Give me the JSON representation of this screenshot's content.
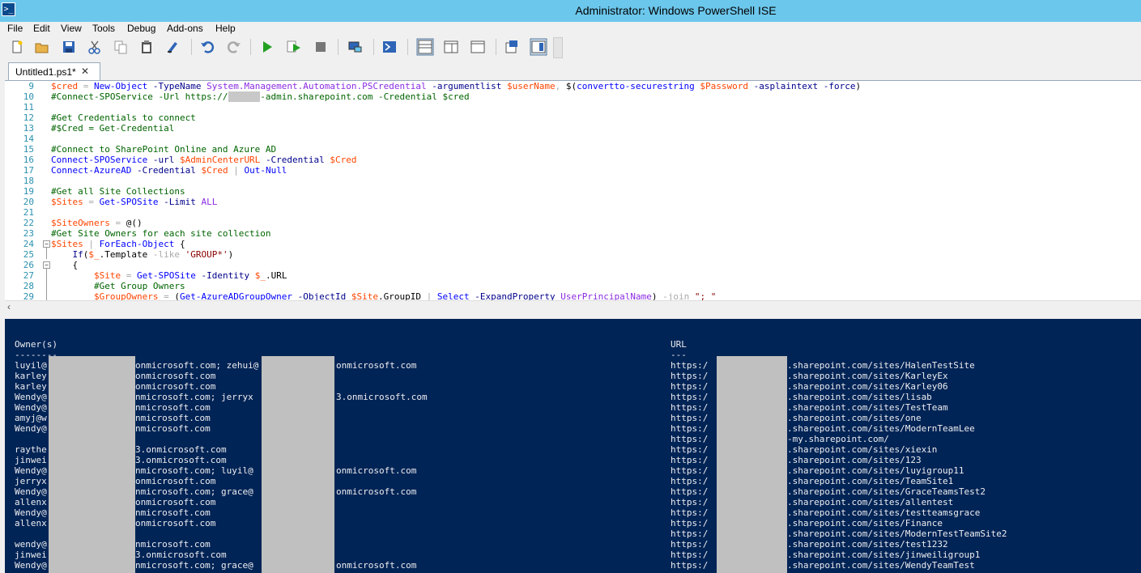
{
  "window": {
    "title": "Administrator: Windows PowerShell ISE"
  },
  "menu": [
    "File",
    "Edit",
    "View",
    "Tools",
    "Debug",
    "Add-ons",
    "Help"
  ],
  "toolbar": {
    "icons": [
      "new-icon",
      "open-icon",
      "save-icon",
      "cut-icon",
      "copy-icon",
      "paste-icon",
      "clear-icon",
      "undo-icon",
      "redo-icon",
      "run-icon",
      "run-selection-icon",
      "stop-icon",
      "remote-icon",
      "powershell-icon",
      "layout-top-icon",
      "layout-right-icon",
      "layout-max-icon",
      "script-pane-icon",
      "commands-icon"
    ]
  },
  "tab": {
    "label": "Untitled1.ps1*",
    "close": "✕"
  },
  "editor": {
    "line_numbers": [
      "9",
      "10",
      "11",
      "12",
      "13",
      "14",
      "15",
      "16",
      "17",
      "18",
      "19",
      "20",
      "21",
      "22",
      "23",
      "24",
      "25",
      "26",
      "27",
      "28",
      "29"
    ]
  },
  "console": {
    "owner_header": "Owner(s)",
    "owner_dash": "--------",
    "url_header": "URL",
    "url_dash": "---",
    "owners_left": [
      "luyil@",
      "karley",
      "karley",
      "Wendy@",
      "Wendy@",
      "amyj@w",
      "Wendy@",
      "",
      "raythe",
      "jinwei",
      "Wendy@",
      "jerryx",
      "Wendy@",
      "allenx",
      "Wendy@",
      "allenx",
      "",
      "wendy@",
      "jinwei",
      "Wendy@"
    ],
    "owners_mid": [
      "onmicrosoft.com; zehui@",
      "onmicrosoft.com",
      "onmicrosoft.com",
      "nmicrosoft.com; jerryx",
      "nmicrosoft.com",
      "nmicrosoft.com",
      "nmicrosoft.com",
      "",
      "3.onmicrosoft.com",
      "3.onmicrosoft.com",
      "nmicrosoft.com; luyil@",
      "onmicrosoft.com",
      "nmicrosoft.com; grace@",
      "onmicrosoft.com",
      "nmicrosoft.com",
      "onmicrosoft.com",
      "",
      "nmicrosoft.com",
      "3.onmicrosoft.com",
      "nmicrosoft.com; grace@"
    ],
    "owners_right": [
      "onmicrosoft.com",
      "",
      "",
      "3.onmicrosoft.com",
      "",
      "",
      "",
      "",
      "",
      "",
      "onmicrosoft.com",
      "",
      "onmicrosoft.com",
      "",
      "",
      "",
      "",
      "",
      "",
      "onmicrosoft.com"
    ],
    "url_prefix": "https:/",
    "urls": [
      ".sharepoint.com/sites/HalenTestSite",
      ".sharepoint.com/sites/KarleyEx",
      ".sharepoint.com/sites/Karley06",
      ".sharepoint.com/sites/lisab",
      ".sharepoint.com/sites/TestTeam",
      ".sharepoint.com/sites/one",
      ".sharepoint.com/sites/ModernTeamLee",
      "-my.sharepoint.com/",
      ".sharepoint.com/sites/xiexin",
      ".sharepoint.com/sites/123",
      ".sharepoint.com/sites/luyigroup11",
      ".sharepoint.com/sites/TeamSite1",
      ".sharepoint.com/sites/GraceTeamsTest2",
      ".sharepoint.com/sites/allentest",
      ".sharepoint.com/sites/testteamsgrace",
      ".sharepoint.com/sites/Finance",
      ".sharepoint.com/sites/ModernTestTeamSite2",
      ".sharepoint.com/sites/test1232",
      ".sharepoint.com/sites/jinweiligroup1",
      ".sharepoint.com/sites/WendyTeamTest"
    ]
  }
}
